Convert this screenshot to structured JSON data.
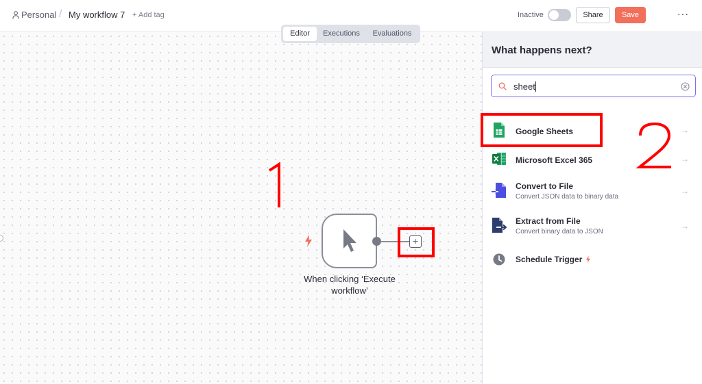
{
  "header": {
    "breadcrumb_personal": "Personal",
    "breadcrumb_separator": "/",
    "workflow_title": "My workflow 7",
    "add_tag": "+ Add tag",
    "status_label": "Inactive",
    "share_label": "Share",
    "save_label": "Save",
    "more_label": "···"
  },
  "tabs": [
    {
      "label": "Editor",
      "active": true
    },
    {
      "label": "Executions",
      "active": false
    },
    {
      "label": "Evaluations",
      "active": false
    }
  ],
  "canvas": {
    "annotation_1": "1",
    "node_label_line1": "When clicking ‘Execute",
    "node_label_line2": "workflow’",
    "add_label": "+"
  },
  "panel": {
    "title": "What happens next?",
    "search_value": "sheet",
    "annotation_2": "2",
    "items": [
      {
        "title": "Google Sheets",
        "subtitle": "",
        "icon": "google-sheets-icon"
      },
      {
        "title": "Microsoft Excel 365",
        "subtitle": "",
        "icon": "excel-icon"
      },
      {
        "title": "Convert to File",
        "subtitle": "Convert JSON data to binary data",
        "icon": "convert-to-file-icon"
      },
      {
        "title": "Extract from File",
        "subtitle": "Convert binary data to JSON",
        "icon": "extract-from-file-icon"
      },
      {
        "title": "Schedule Trigger",
        "subtitle": "",
        "icon": "clock-icon"
      }
    ],
    "arrow": "→"
  },
  "colors": {
    "accent": "#f26f5c",
    "annotation": "#ff0000",
    "search_border": "#7b6ff0",
    "sheets_green": "#1fa463",
    "excel_green": "#107c41"
  }
}
